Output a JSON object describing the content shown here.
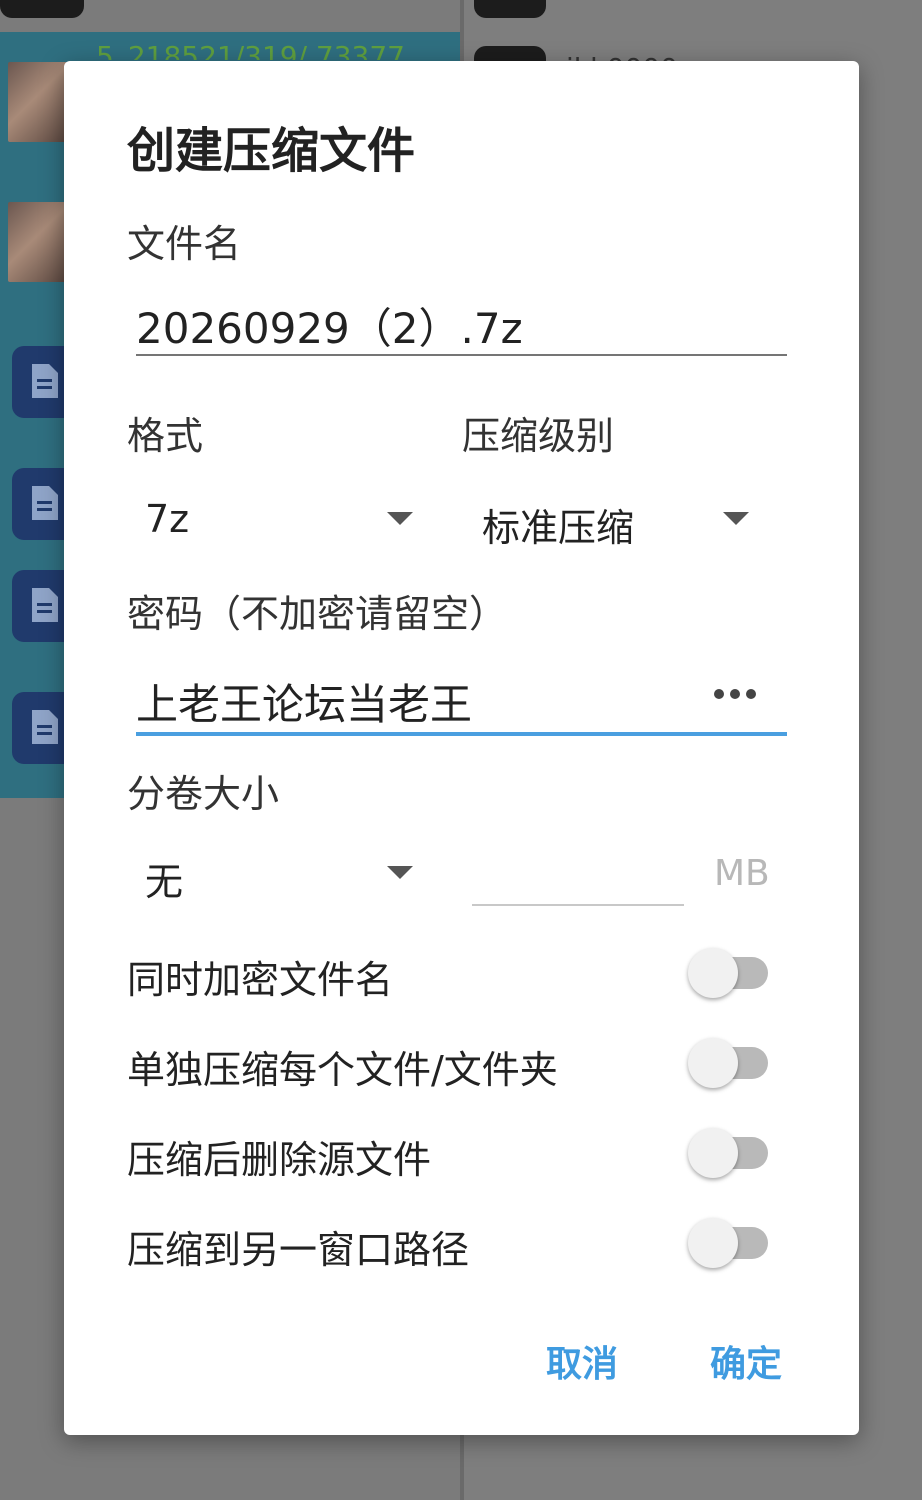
{
  "dialog": {
    "title": "创建压缩文件",
    "filename_label": "文件名",
    "filename_value": "20260929（2）.7z",
    "format_label": "格式",
    "format_value": "7z",
    "level_label": "压缩级别",
    "level_value": "标准压缩",
    "password_label": "密码（不加密请留空）",
    "password_value": "上老王论坛当老王",
    "split_label": "分卷大小",
    "split_value": "无",
    "split_size_value": "",
    "split_unit": "MB",
    "toggles": [
      {
        "label": "同时加密文件名",
        "on": false
      },
      {
        "label": "单独压缩每个文件/文件夹",
        "on": false
      },
      {
        "label": "压缩后删除源文件",
        "on": false
      },
      {
        "label": "压缩到另一窗口路径",
        "on": false
      }
    ],
    "cancel_label": "取消",
    "ok_label": "确定",
    "accent_color": "#4a9fe0"
  },
  "background": {
    "left_top_text": "5_218521/319/ 73377",
    "right_item_text": "jkl 0000"
  }
}
